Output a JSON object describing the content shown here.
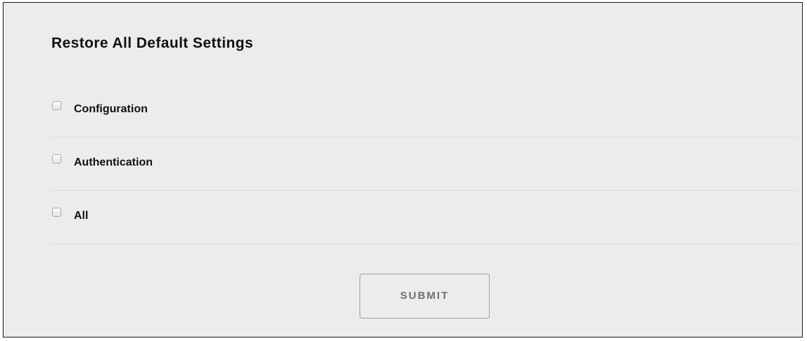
{
  "form": {
    "title": "Restore All Default Settings",
    "options": [
      {
        "label": "Configuration",
        "checked": false
      },
      {
        "label": "Authentication",
        "checked": false
      },
      {
        "label": "All",
        "checked": false
      }
    ],
    "submit_label": "SUBMIT"
  },
  "colors": {
    "panel_background": "#ececec",
    "panel_border": "#1a1a1a",
    "row_divider": "#dcdcdc",
    "button_border": "#9e9e9e",
    "button_text": "#6f6f6f"
  }
}
